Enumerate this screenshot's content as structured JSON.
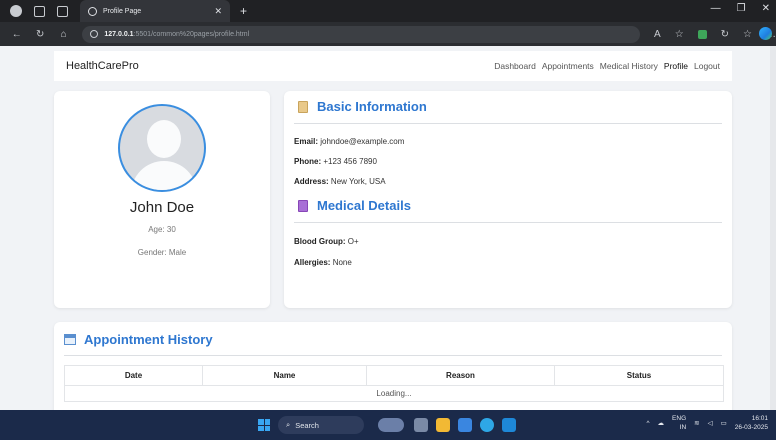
{
  "browser": {
    "tab_title": "Profile Page",
    "url_host": "127.0.0.1",
    "url_path": ":5501/common%20pages/profile.html"
  },
  "navbar": {
    "brand": "HealthCarePro",
    "links": [
      "Dashboard",
      "Appointments",
      "Medical History",
      "Profile",
      "Logout"
    ]
  },
  "profile": {
    "name": "John Doe",
    "age": "Age: 30",
    "gender": "Gender: Male"
  },
  "basic": {
    "title": "Basic Information",
    "email_label": "Email:",
    "email": " johndoe@example.com",
    "phone_label": "Phone:",
    "phone": " +123 456 7890",
    "address_label": "Address:",
    "address": " New York, USA"
  },
  "medical": {
    "title": "Medical Details",
    "blood_label": "Blood Group:",
    "blood": " O+",
    "allergies_label": "Allergies:",
    "allergies": " None"
  },
  "appointments": {
    "title": "Appointment History",
    "columns": [
      "Date",
      "Name",
      "Reason",
      "Status"
    ],
    "loading": "Loading..."
  },
  "taskbar": {
    "search": "Search",
    "lang_top": "ENG",
    "lang_bottom": "IN",
    "time": "16:01",
    "date": "26-03-2025"
  }
}
